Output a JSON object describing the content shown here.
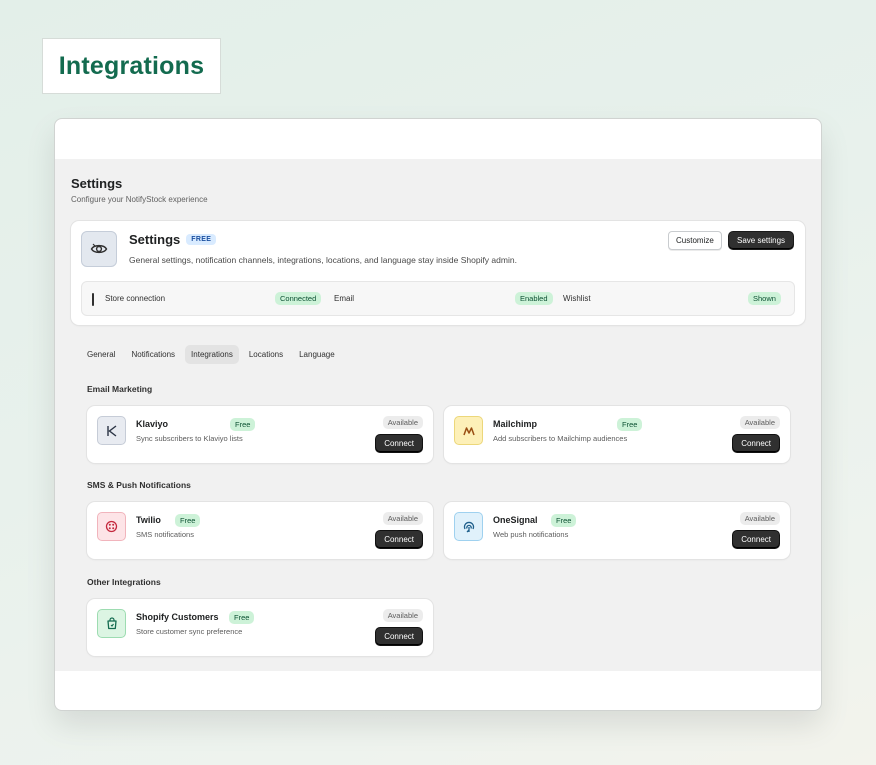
{
  "page_title": "Integrations",
  "app": {
    "title": "Settings",
    "subtitle": "Configure your NotifyStock experience"
  },
  "hero": {
    "title": "Settings",
    "badge": "FREE",
    "description": "General settings, notification channels, integrations, locations, and language stay inside Shopify admin.",
    "customize_label": "Customize",
    "save_label": "Save settings",
    "icon": "eye-icon"
  },
  "status": [
    {
      "label": "Store connection",
      "value": "Connected"
    },
    {
      "label": "Email",
      "value": "Enabled"
    },
    {
      "label": "Wishlist",
      "value": "Shown"
    }
  ],
  "tabs": [
    {
      "label": "General",
      "active": false
    },
    {
      "label": "Notifications",
      "active": false
    },
    {
      "label": "Integrations",
      "active": true
    },
    {
      "label": "Locations",
      "active": false
    },
    {
      "label": "Language",
      "active": false
    }
  ],
  "sections": [
    {
      "title": "Email Marketing",
      "items": [
        {
          "name": "Klaviyo",
          "badge": "Free",
          "description": "Sync subscribers to Klaviyo lists",
          "status": "Available",
          "action": "Connect",
          "icon": "klaviyo-icon",
          "icon_glyph": "K"
        },
        {
          "name": "Mailchimp",
          "badge": "Free",
          "description": "Add subscribers to Mailchimp audiences",
          "status": "Available",
          "action": "Connect",
          "icon": "mailchimp-icon",
          "icon_glyph": "M"
        }
      ]
    },
    {
      "title": "SMS & Push Notifications",
      "items": [
        {
          "name": "Twilio",
          "badge": "Free",
          "description": "SMS notifications",
          "status": "Available",
          "action": "Connect",
          "icon": "twilio-icon",
          "icon_glyph": ""
        },
        {
          "name": "OneSignal",
          "badge": "Free",
          "description": "Web push notifications",
          "status": "Available",
          "action": "Connect",
          "icon": "onesignal-icon",
          "icon_glyph": ""
        }
      ]
    },
    {
      "title": "Other Integrations",
      "items": [
        {
          "name": "Shopify Customers",
          "badge": "Free",
          "description": "Store customer sync preference",
          "status": "Available",
          "action": "Connect",
          "icon": "shopify-bag-icon",
          "icon_glyph": ""
        }
      ]
    }
  ],
  "colors": {
    "title_green": "#136b4f",
    "dark_button": "#303030",
    "success_bg": "#cdf2d8",
    "success_text": "#0c5132"
  }
}
